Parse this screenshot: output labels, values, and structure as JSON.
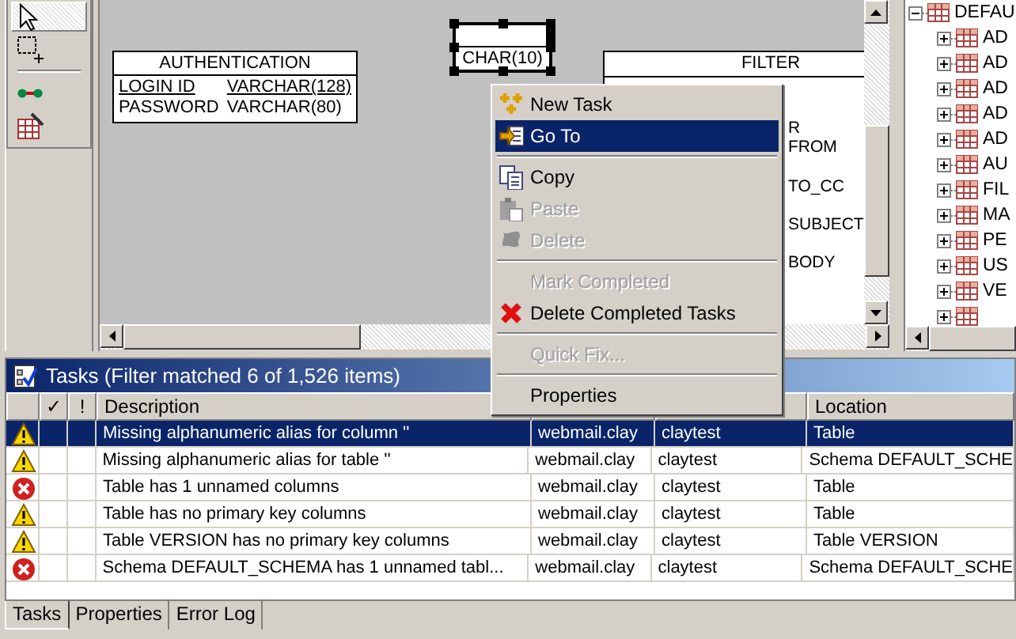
{
  "palette": {
    "tools": [
      {
        "kind": "select",
        "selected": true
      },
      {
        "kind": "marquee",
        "selected": false
      },
      {
        "kind": "connection",
        "selected": false
      },
      {
        "kind": "table",
        "selected": false
      }
    ]
  },
  "diagram": {
    "tables": [
      {
        "kind": "table",
        "title": "AUTHENTICATION",
        "rows": [
          {
            "name": "LOGIN ID",
            "type": "VARCHAR(128)",
            "key": true
          },
          {
            "name": "PASSWORD",
            "type": "VARCHAR(80)",
            "key": false
          }
        ]
      },
      {
        "kind": "selected-box",
        "title": "CHAR(10)"
      },
      {
        "kind": "partial",
        "title": "FILTER",
        "rows": [
          "R",
          "FROM",
          "TO_CC",
          "SUBJECT",
          "BODY"
        ]
      }
    ]
  },
  "tree": {
    "items": [
      {
        "label": "DEFAU",
        "expanded": true,
        "children": [
          {
            "label": "AD",
            "expanded": false
          },
          {
            "label": "AD",
            "expanded": false
          },
          {
            "label": "AD",
            "expanded": false
          },
          {
            "label": "AD",
            "expanded": false
          },
          {
            "label": "AD",
            "expanded": false
          },
          {
            "label": "AU",
            "expanded": false
          },
          {
            "label": "FIL",
            "expanded": false
          },
          {
            "label": "MA",
            "expanded": false
          },
          {
            "label": "PE",
            "expanded": false
          },
          {
            "label": "US",
            "expanded": false
          },
          {
            "label": "VE",
            "expanded": false
          },
          {
            "expanded": false
          }
        ]
      }
    ]
  },
  "context_menu": {
    "items": [
      {
        "kind": "new-task",
        "label": "New Task",
        "disabled": false,
        "selected": false
      },
      {
        "kind": "go-to",
        "label": "Go To",
        "disabled": false,
        "selected": true
      },
      {
        "kind": "separator"
      },
      {
        "kind": "copy",
        "label": "Copy",
        "disabled": false,
        "selected": false
      },
      {
        "kind": "paste",
        "label": "Paste",
        "disabled": true,
        "selected": false
      },
      {
        "kind": "delete",
        "label": "Delete",
        "disabled": true,
        "selected": false
      },
      {
        "kind": "separator"
      },
      {
        "kind": "plain",
        "label": "Mark Completed",
        "disabled": true,
        "selected": false
      },
      {
        "kind": "delete-completed",
        "label": "Delete Completed Tasks",
        "disabled": false,
        "selected": false
      },
      {
        "kind": "separator"
      },
      {
        "kind": "plain",
        "label": "Quick Fix...",
        "disabled": true,
        "selected": false
      },
      {
        "kind": "separator"
      },
      {
        "kind": "plain",
        "label": "Properties",
        "disabled": false,
        "selected": false
      }
    ]
  },
  "tasks_view": {
    "title": "Tasks (Filter matched 6 of 1,526 items)",
    "columns": [
      {
        "kind": "icon"
      },
      {
        "kind": "text",
        "label": "✓"
      },
      {
        "kind": "text",
        "label": "!"
      },
      {
        "kind": "text",
        "label": "Description"
      },
      {
        "kind": "hidden"
      },
      {
        "kind": "hidden"
      },
      {
        "kind": "text",
        "label": "Location"
      }
    ],
    "rows": [
      {
        "kind": "warning",
        "selected": true,
        "description": "Missing alphanumeric alias for column ''",
        "resource": "webmail.clay",
        "folder": "claytest",
        "location": "Table"
      },
      {
        "kind": "warning",
        "selected": false,
        "description": "Missing alphanumeric alias for table ''",
        "resource": "webmail.clay",
        "folder": "claytest",
        "location": "Schema DEFAULT_SCHE"
      },
      {
        "kind": "error",
        "selected": false,
        "description": "Table  has 1 unnamed columns",
        "resource": "webmail.clay",
        "folder": "claytest",
        "location": "Table"
      },
      {
        "kind": "warning",
        "selected": false,
        "description": "Table  has no primary key columns",
        "resource": "webmail.clay",
        "folder": "claytest",
        "location": "Table"
      },
      {
        "kind": "warning",
        "selected": false,
        "description": "Table VERSION has no primary key columns",
        "resource": "webmail.clay",
        "folder": "claytest",
        "location": "Table VERSION"
      },
      {
        "kind": "error",
        "selected": false,
        "description": "Schema DEFAULT_SCHEMA has 1 unnamed tabl...",
        "resource": "webmail.clay",
        "folder": "claytest",
        "location": "Schema DEFAULT_SCHE"
      }
    ]
  },
  "bottom_tabs": [
    {
      "label": "Tasks",
      "selected": true
    },
    {
      "label": "Properties",
      "selected": false
    },
    {
      "label": "Error Log",
      "selected": false
    }
  ]
}
